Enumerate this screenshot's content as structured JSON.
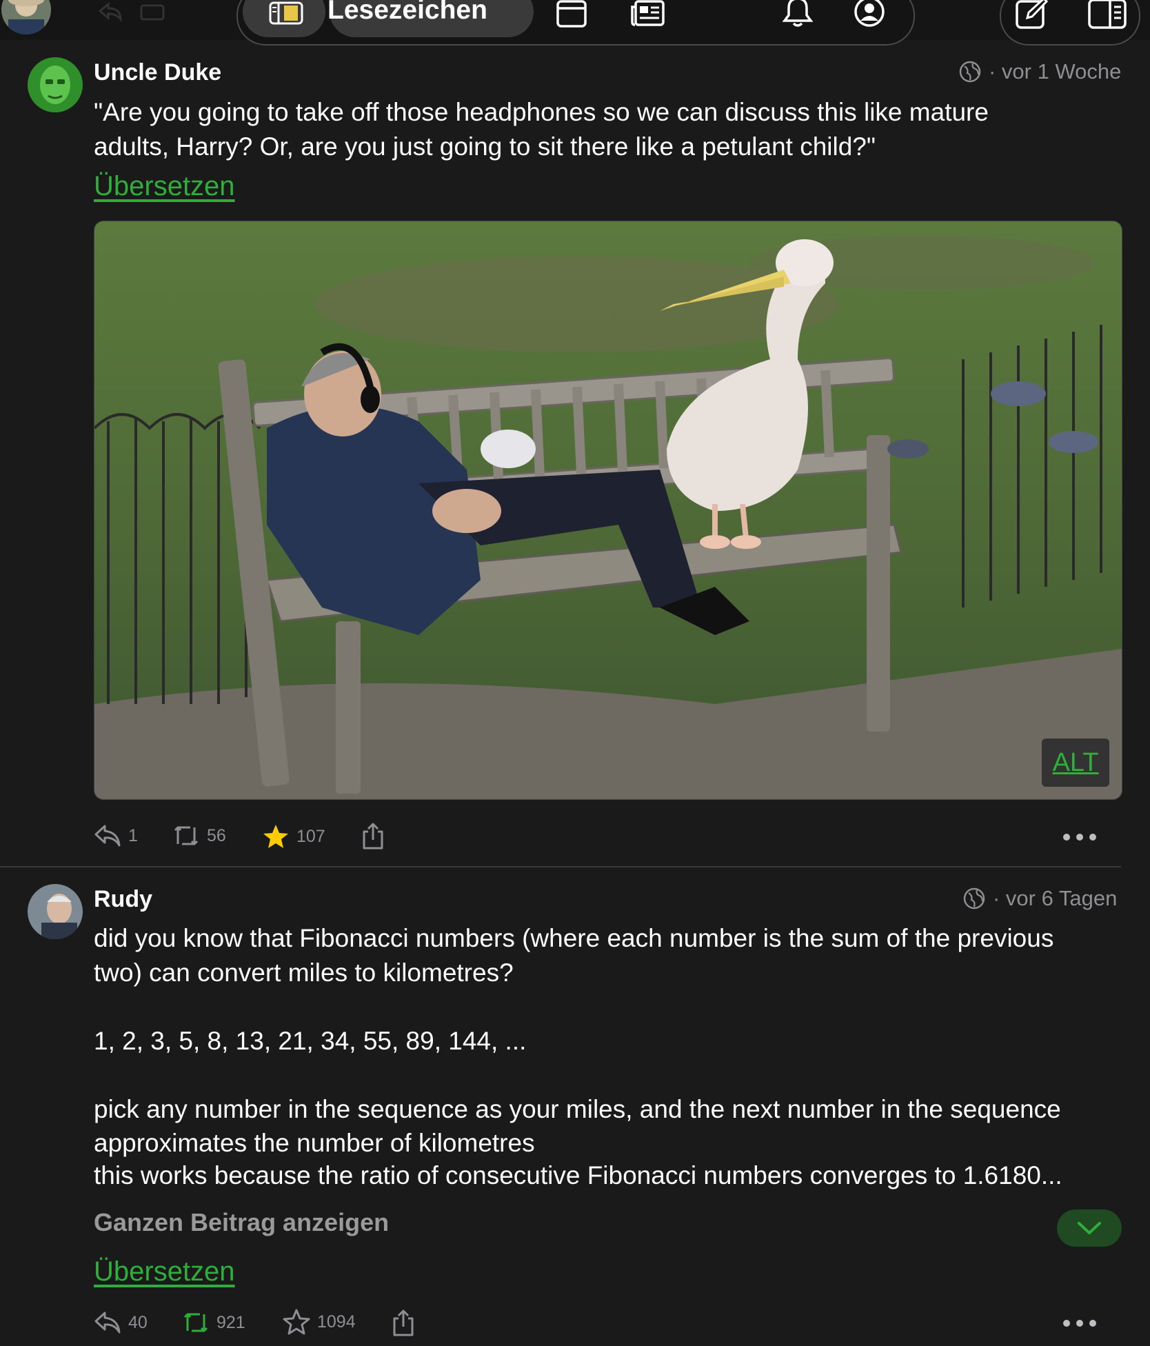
{
  "colors": {
    "background": "#1a1a1a",
    "accent_green": "#2fae3a",
    "muted_text": "#8e8e93",
    "star_yellow": "#ffcc00"
  },
  "header": {
    "title": "Lesezeichen",
    "icons": [
      "sidebar-toggle-icon",
      "tab-window-icon",
      "news-feed-icon",
      "bell-icon",
      "profile-icon",
      "compose-icon",
      "split-view-icon"
    ]
  },
  "posts": [
    {
      "author": "Uncle Duke",
      "visibility_icon": "globe-public-icon",
      "time": "· vor 1 Woche",
      "text_lines": [
        "\"Are you going to take off those headphones so we can discuss this like mature",
        "adults, Harry? Or, are you just going to sit there like a petulant child?\""
      ],
      "translate": "Übersetzen",
      "media": {
        "description_icon": "photo-man-on-bench-with-pelican",
        "alt_badge": "ALT"
      },
      "actions": {
        "replies": "1",
        "boosts": "56",
        "favourites": "107",
        "favourited": true
      }
    },
    {
      "author": "Rudy",
      "visibility_icon": "globe-public-icon",
      "time": "· vor 6 Tagen",
      "text_lines": [
        "did you know that Fibonacci numbers (where each number is the sum of the previous",
        "two) can convert miles to kilometres?",
        "",
        "1, 2, 3, 5, 8, 13, 21, 34, 55, 89, 144, ...",
        "",
        "pick any number in the sequence as your miles, and the next number in the sequence",
        "approximates the number of kilometres",
        "this works because the ratio of consecutive Fibonacci numbers converges to 1.6180..."
      ],
      "show_more": "Ganzen Beitrag anzeigen",
      "translate": "Übersetzen",
      "actions": {
        "replies": "40",
        "boosts": "921",
        "favourites": "1094",
        "favourited": false
      }
    }
  ]
}
